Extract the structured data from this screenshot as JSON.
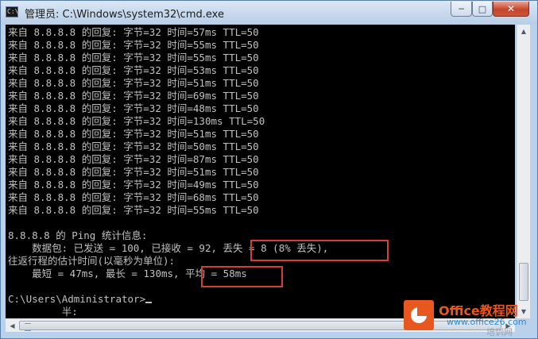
{
  "window": {
    "title": "管理员: C:\\Windows\\system32\\cmd.exe",
    "buttons": {
      "minimize": "─",
      "maximize": "□",
      "close": "✕"
    }
  },
  "console": {
    "lines": [
      "来自 8.8.8.8 的回复: 字节=32 时间=57ms TTL=50",
      "来自 8.8.8.8 的回复: 字节=32 时间=55ms TTL=50",
      "来自 8.8.8.8 的回复: 字节=32 时间=55ms TTL=50",
      "来自 8.8.8.8 的回复: 字节=32 时间=53ms TTL=50",
      "来自 8.8.8.8 的回复: 字节=32 时间=51ms TTL=50",
      "来自 8.8.8.8 的回复: 字节=32 时间=69ms TTL=50",
      "来自 8.8.8.8 的回复: 字节=32 时间=48ms TTL=50",
      "来自 8.8.8.8 的回复: 字节=32 时间=130ms TTL=50",
      "来自 8.8.8.8 的回复: 字节=32 时间=51ms TTL=50",
      "来自 8.8.8.8 的回复: 字节=32 时间=50ms TTL=50",
      "来自 8.8.8.8 的回复: 字节=32 时间=87ms TTL=50",
      "来自 8.8.8.8 的回复: 字节=32 时间=51ms TTL=50",
      "来自 8.8.8.8 的回复: 字节=32 时间=49ms TTL=50",
      "来自 8.8.8.8 的回复: 字节=32 时间=68ms TTL=50",
      "来自 8.8.8.8 的回复: 字节=32 时间=55ms TTL=50",
      "",
      "8.8.8.8 的 Ping 统计信息:",
      "    数据包: 已发送 = 100, 已接收 = 92, 丢失 = 8 (8% 丢失),",
      "往返行程的估计时间(以毫秒为单位):",
      "    最短 = 47ms, 最长 = 130ms, 平均 = 58ms",
      "",
      "C:\\Users\\Administrator>",
      "         半:"
    ]
  },
  "watermark": {
    "brand": "Office教程网",
    "url": "www.office26.com",
    "corner": "培训网"
  }
}
